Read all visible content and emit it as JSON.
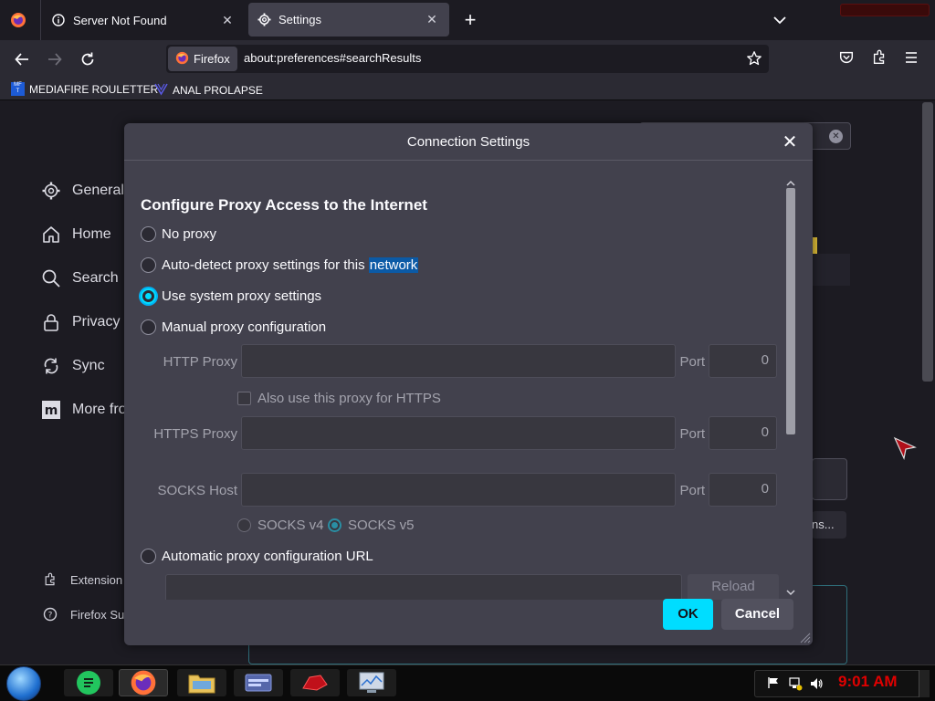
{
  "tabs": [
    {
      "label": "Server Not Found",
      "icon": "info-icon"
    },
    {
      "label": "Settings",
      "icon": "gear-icon"
    }
  ],
  "navbar": {
    "identity": "Firefox",
    "url": "about:preferences#searchResults"
  },
  "bookmarks": [
    {
      "label": "MEDIAFIRE ROULETTER",
      "icon_text": "MF T"
    },
    {
      "label": "ANAL PROLAPSE"
    }
  ],
  "sidebar": {
    "items": [
      {
        "label": "General",
        "icon": "gear-icon"
      },
      {
        "label": "Home",
        "icon": "home-icon"
      },
      {
        "label": "Search",
        "icon": "search-icon"
      },
      {
        "label": "Privacy &",
        "icon": "lock-icon"
      },
      {
        "label": "Sync",
        "icon": "sync-icon"
      },
      {
        "label": "More fro",
        "icon": "mozilla-icon"
      }
    ],
    "footer": [
      {
        "label": "Extension",
        "icon": "puzzle-icon"
      },
      {
        "label": "Firefox Su",
        "icon": "help-icon"
      }
    ]
  },
  "background": {
    "button_partial": "ns..."
  },
  "dialog": {
    "title": "Connection Settings",
    "heading": "Configure Proxy Access to the Internet",
    "options": [
      {
        "label": "No proxy",
        "selected": false
      },
      {
        "label": "Auto-detect proxy settings for this ",
        "highlight": "network",
        "selected": false
      },
      {
        "label": "Use system proxy settings",
        "selected": true
      },
      {
        "label": "Manual proxy configuration",
        "selected": false
      }
    ],
    "http_proxy_label": "HTTP Proxy",
    "https_proxy_label": "HTTPS Proxy",
    "socks_host_label": "SOCKS Host",
    "port_label": "Port",
    "http_port": "0",
    "https_port": "0",
    "socks_port": "0",
    "also_https_label": "Also use this proxy for HTTPS",
    "socks_v4_label": "SOCKS v4",
    "socks_v5_label": "SOCKS v5",
    "auto_url_label": "Automatic proxy configuration URL",
    "reload_label": "Reload",
    "ok_label": "OK",
    "cancel_label": "Cancel"
  },
  "taskbar": {
    "clock": "9:01 AM"
  },
  "colors": {
    "accent": "#00ddff",
    "dialog_bg": "#42414d",
    "page_bg": "#1c1b22",
    "clock": "#e00000"
  }
}
